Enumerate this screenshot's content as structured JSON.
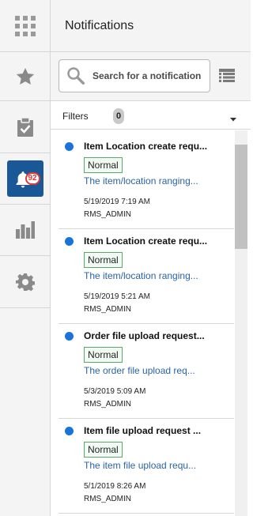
{
  "rail": {
    "items": [
      {
        "name": "apps-grid",
        "icon": "grid-icon"
      },
      {
        "name": "favorites",
        "icon": "star-icon"
      },
      {
        "name": "tasks",
        "icon": "clipboard-check-icon"
      },
      {
        "name": "notifications",
        "icon": "bell-icon",
        "badge": "92",
        "active": true
      },
      {
        "name": "reports",
        "icon": "bar-chart-icon"
      },
      {
        "name": "settings",
        "icon": "gear-icon"
      }
    ]
  },
  "panel": {
    "title": "Notifications",
    "search": {
      "placeholder": "Search for a notification"
    },
    "filters": {
      "label": "Filters",
      "count": "0"
    }
  },
  "notifications": [
    {
      "title": "Item Location create requ...",
      "priority": "Normal",
      "description": "The item/location ranging...",
      "date": "5/19/2019 7:19 AM",
      "user": "RMS_ADMIN"
    },
    {
      "title": "Item Location create requ...",
      "priority": "Normal",
      "description": "The item/location ranging...",
      "date": "5/19/2019 5:21 AM",
      "user": "RMS_ADMIN"
    },
    {
      "title": "Order file upload request...",
      "priority": "Normal",
      "description": "The order file upload req...",
      "date": "5/3/2019 5:09 AM",
      "user": "RMS_ADMIN"
    },
    {
      "title": "Item file upload request ...",
      "priority": "Normal",
      "description": "The item file upload requ...",
      "date": "5/1/2019 8:26 AM",
      "user": "RMS_ADMIN"
    }
  ],
  "colors": {
    "accent": "#1a5796",
    "unread": "#1a73d9",
    "link": "#2a63a8",
    "badge": "#d73b3b",
    "priority_border": "#58a86a"
  }
}
